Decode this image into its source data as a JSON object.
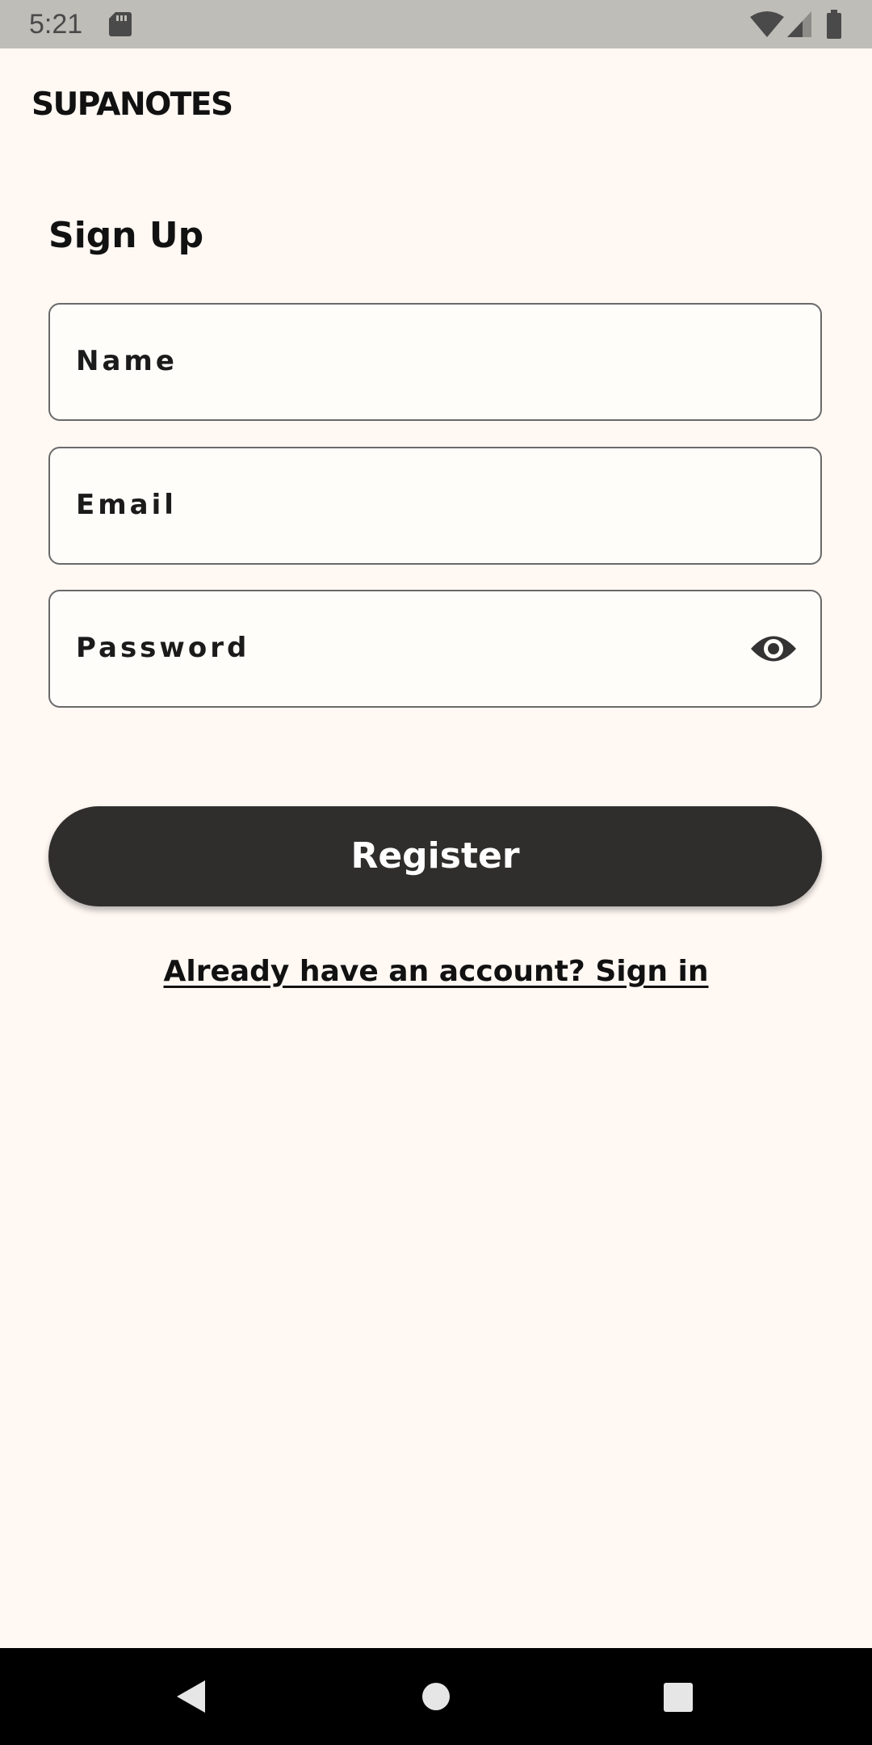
{
  "status_bar": {
    "time": "5:21",
    "icons": [
      "sd-card-icon",
      "wifi-icon",
      "cell-signal-icon",
      "battery-icon"
    ]
  },
  "app": {
    "brand": "SUPANOTES"
  },
  "form": {
    "title": "Sign Up",
    "name_label": "Name",
    "email_label": "Email",
    "password_label": "Password",
    "password_toggle_icon": "eye-icon",
    "register_label": "Register",
    "signin_link": "Already have an account? Sign in"
  },
  "nav_bar": {
    "icons": [
      "back-icon",
      "home-icon",
      "recents-icon"
    ]
  },
  "colors": {
    "background": "#FFF8F3",
    "status_bar": "#BFBDB8",
    "button": "#2F2E2D",
    "field_border": "#6A6A6A"
  }
}
